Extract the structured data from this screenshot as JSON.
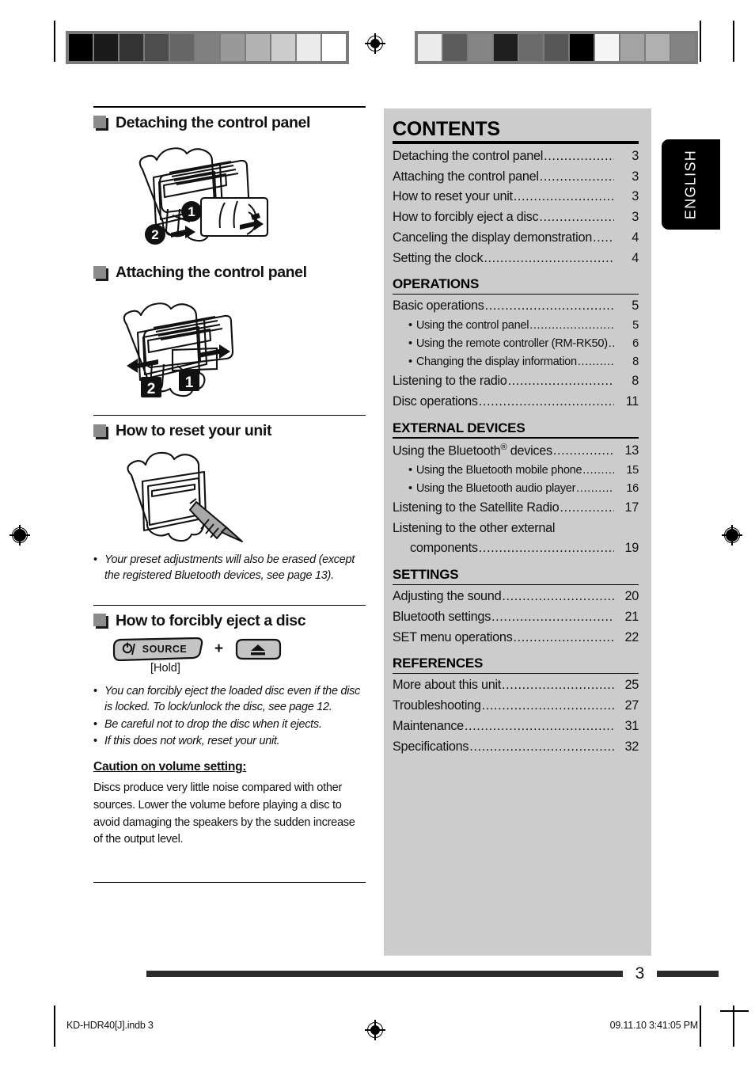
{
  "page": {
    "number": "3",
    "language_tab": "ENGLISH"
  },
  "left_column": {
    "sections": [
      {
        "title": "Detaching the control panel",
        "figure": "detaching-control-panel-illustration"
      },
      {
        "title": "Attaching the control panel",
        "figure": "attaching-control-panel-illustration"
      },
      {
        "title": "How to reset your unit",
        "figure": "reset-unit-illustration"
      },
      {
        "title": "How to forcibly eject a disc",
        "figure": "eject-button-combo-illustration"
      }
    ],
    "reset_notes": [
      "Your preset adjustments will also be erased (except the registered Bluetooth devices, see page 13)."
    ],
    "eject_buttons": {
      "source_button_label": "/SOURCE",
      "power_icon": "power-icon",
      "plus": "+",
      "eject_icon": "eject-icon",
      "hold_label": "[Hold]"
    },
    "eject_notes": [
      "You can forcibly eject the loaded disc even if the disc is locked. To lock/unlock the disc, see page 12.",
      "Be careful not to drop the disc when it ejects.",
      "If this does not work, reset your unit."
    ],
    "caution": {
      "heading": "Caution on volume setting:",
      "body": "Discs produce very little noise compared with other sources. Lower the volume before playing a disc to avoid damaging the speakers by the sudden increase of the output level."
    }
  },
  "contents": {
    "title": "CONTENTS",
    "intro_entries": [
      {
        "label": "Detaching the control panel",
        "page": "3",
        "level": "main"
      },
      {
        "label": "Attaching the control panel",
        "page": "3",
        "level": "main"
      },
      {
        "label": "How to reset your unit",
        "page": "3",
        "level": "main"
      },
      {
        "label": "How to forcibly eject a disc",
        "page": "3",
        "level": "main"
      },
      {
        "label": "Canceling the display demonstration",
        "page": "4",
        "level": "main"
      },
      {
        "label": "Setting the clock",
        "page": "4",
        "level": "main"
      }
    ],
    "groups": [
      {
        "heading": "OPERATIONS",
        "entries": [
          {
            "label": "Basic operations",
            "page": "5",
            "level": "main"
          },
          {
            "label": "Using the control panel",
            "page": "5",
            "level": "sub"
          },
          {
            "label": "Using the remote controller (RM-RK50)",
            "page": "6",
            "level": "sub"
          },
          {
            "label": "Changing the display information",
            "page": "8",
            "level": "sub"
          },
          {
            "label": "Listening to the radio",
            "page": "8",
            "level": "main"
          },
          {
            "label": "Disc operations",
            "page": "11",
            "level": "main"
          }
        ]
      },
      {
        "heading": "EXTERNAL DEVICES",
        "entries": [
          {
            "label": "Using the Bluetooth® devices",
            "page": "13",
            "level": "main"
          },
          {
            "label": "Using the Bluetooth mobile phone",
            "page": "15",
            "level": "sub"
          },
          {
            "label": "Using the Bluetooth audio player",
            "page": "16",
            "level": "sub"
          },
          {
            "label": "Listening to the Satellite Radio",
            "page": "17",
            "level": "main"
          },
          {
            "label": "Listening to the other external",
            "page": "",
            "level": "wrap"
          },
          {
            "label": "components",
            "page": "19",
            "level": "cont"
          }
        ]
      },
      {
        "heading": "SETTINGS",
        "entries": [
          {
            "label": "Adjusting the sound",
            "page": "20",
            "level": "main"
          },
          {
            "label": "Bluetooth settings",
            "page": "21",
            "level": "main"
          },
          {
            "label": "SET menu operations",
            "page": "22",
            "level": "main"
          }
        ]
      },
      {
        "heading": "REFERENCES",
        "entries": [
          {
            "label": "More about this unit",
            "page": "25",
            "level": "main"
          },
          {
            "label": "Troubleshooting",
            "page": "27",
            "level": "main"
          },
          {
            "label": "Maintenance",
            "page": "31",
            "level": "main"
          },
          {
            "label": "Specifications",
            "page": "32",
            "level": "main"
          }
        ]
      }
    ]
  },
  "footer": {
    "file_label": "KD-HDR40[J].indb   3",
    "timestamp": "09.11.10   3:41:05 PM"
  },
  "print_marks": {
    "wedge_left_steps": [
      "#000000",
      "#1a1a1a",
      "#333333",
      "#4d4d4d",
      "#666666",
      "#808080",
      "#999999",
      "#b3b3b3",
      "#cccccc",
      "#ebebeb",
      "#ffffff"
    ],
    "wedge_right_steps": [
      "#ebebeb",
      "#5c5c5c",
      "#858585",
      "#1f1f1f",
      "#6b6b6b",
      "#575757",
      "#000000",
      "#f5f5f5",
      "#a3a3a3",
      "#b0b0b0",
      "#838383"
    ]
  }
}
